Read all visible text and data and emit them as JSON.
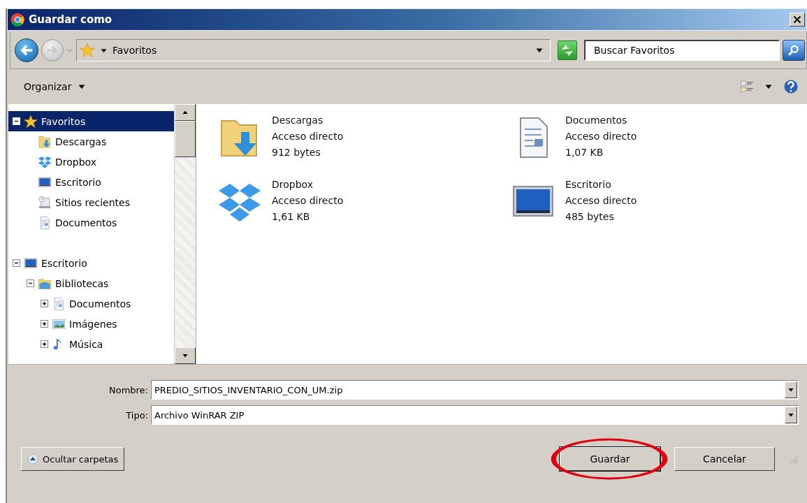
{
  "window": {
    "title": "Guardar como"
  },
  "address_bar": {
    "location": "Favoritos"
  },
  "search": {
    "placeholder": "Buscar Favoritos"
  },
  "toolbar": {
    "organize": "Organizar"
  },
  "tree": [
    {
      "label": "Favoritos",
      "kind": "star",
      "expanded": true,
      "selected": true,
      "children": [
        {
          "label": "Descargas",
          "kind": "downloads",
          "selected": false
        },
        {
          "label": "Dropbox",
          "kind": "dropbox",
          "selected": false
        },
        {
          "label": "Escritorio",
          "kind": "desktop",
          "selected": false
        },
        {
          "label": "Sitios recientes",
          "kind": "recent",
          "selected": false
        },
        {
          "label": "Documentos",
          "kind": "document",
          "selected": false
        }
      ]
    },
    {
      "label": "Escritorio",
      "kind": "desktop",
      "expanded": true,
      "selected": false,
      "children": [
        {
          "label": "Bibliotecas",
          "kind": "library",
          "expanded": true,
          "selected": false,
          "children": [
            {
              "label": "Documentos",
              "kind": "document",
              "expanded": false,
              "selected": false
            },
            {
              "label": "Imágenes",
              "kind": "images",
              "expanded": false,
              "selected": false
            },
            {
              "label": "Música",
              "kind": "music",
              "expanded": false,
              "selected": false
            }
          ]
        }
      ]
    }
  ],
  "files": [
    {
      "name": "Descargas",
      "type": "Acceso directo",
      "size": "912 bytes",
      "kind": "downloads"
    },
    {
      "name": "Documentos",
      "type": "Acceso directo",
      "size": "1,07 KB",
      "kind": "document"
    },
    {
      "name": "Dropbox",
      "type": "Acceso directo",
      "size": "1,61 KB",
      "kind": "dropbox"
    },
    {
      "name": "Escritorio",
      "type": "Acceso directo",
      "size": "485 bytes",
      "kind": "desktop"
    }
  ],
  "form": [
    {
      "label": "Nombre:",
      "value": "PREDIO_SITIOS_INVENTARIO_CON_UM.zip"
    },
    {
      "label": "Tipo:",
      "value": "Archivo WinRAR ZIP"
    }
  ],
  "hide_folders": "Ocultar carpetas",
  "buttons": [
    {
      "label": "Guardar",
      "highlighted": true
    },
    {
      "label": "Cancelar",
      "highlighted": false
    }
  ]
}
